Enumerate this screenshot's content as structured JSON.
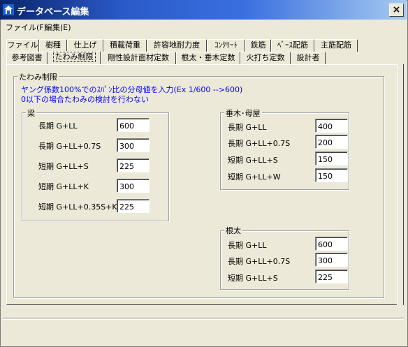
{
  "window": {
    "title": "データベース編集",
    "close_glyph": "×"
  },
  "menu": [
    "ファイル(F)",
    "編集(E)"
  ],
  "tabs_row1": [
    "ファイル",
    "樹種",
    "仕上げ",
    "積載荷重",
    "許容地耐力度",
    "ｺﾝｸﾘｰﾄ",
    "鉄筋",
    "ﾍﾞｰｽ配筋",
    "主筋配筋"
  ],
  "tabs_row2": [
    "参考図書",
    "たわみ制限",
    "剛性設計面材定数",
    "根太・垂木定数",
    "火打ち定数",
    "設計者"
  ],
  "active_tab": "たわみ制限",
  "panel": {
    "group_title": "たわみ制限",
    "note1": "ヤング係数100%でのｽﾊﾟﾝ比の分母値を入力(Ex 1/600 -->600)",
    "note2": "0以下の場合たわみの検討を行わない"
  },
  "beam": {
    "title": "梁",
    "rows": [
      {
        "label": "長期  G+LL",
        "value": "600"
      },
      {
        "label": "長期  G+LL+0.7S",
        "value": "300"
      },
      {
        "label": "短期  G+LL+S",
        "value": "225"
      },
      {
        "label": "短期  G+LL+K",
        "value": "300"
      },
      {
        "label": "短期  G+LL+0.35S+K",
        "value": "225"
      }
    ]
  },
  "rafter": {
    "title": "垂木･母屋",
    "rows": [
      {
        "label": "長期  G+LL",
        "value": "400"
      },
      {
        "label": "長期  G+LL+0.7S",
        "value": "200"
      },
      {
        "label": "短期  G+LL+S",
        "value": "150"
      },
      {
        "label": "短期  G+LL+W",
        "value": "150"
      }
    ]
  },
  "joist": {
    "title": "根太",
    "rows": [
      {
        "label": "長期  G+LL",
        "value": "600"
      },
      {
        "label": "長期  G+LL+0.7S",
        "value": "300"
      },
      {
        "label": "短期  G+LL+S",
        "value": "225"
      }
    ]
  },
  "colors": {
    "title_start": "#0a246a",
    "title_end": "#a6caf0",
    "note": "#0000ff",
    "face": "#ece9d8"
  }
}
